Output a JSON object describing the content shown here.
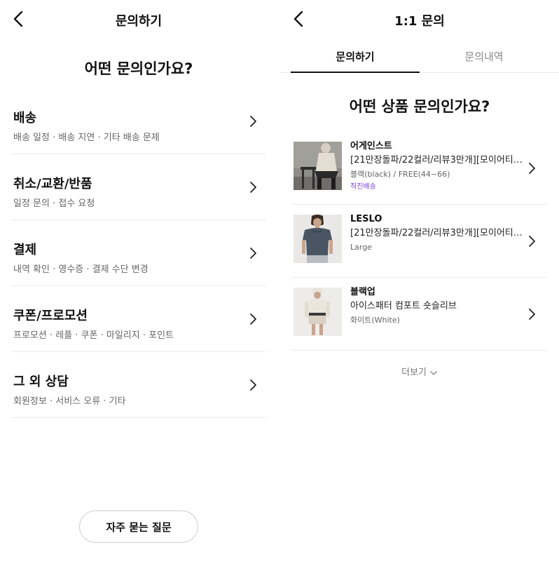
{
  "left": {
    "title": "문의하기",
    "question": "어떤 문의인가요?",
    "categories": [
      {
        "title": "배송",
        "sub": "배송 일정 · 배송 지연 · 기타 배송 문제"
      },
      {
        "title": "취소/교환/반품",
        "sub": "일정 문의 · 접수 요청"
      },
      {
        "title": "결제",
        "sub": "내역 확인 · 영수증 · 결제 수단 변경"
      },
      {
        "title": "쿠폰/프로모션",
        "sub": "프로모션 · 레플 · 쿠폰 · 마일리지 · 포인트"
      },
      {
        "title": "그 외 상담",
        "sub": "회원정보 · 서비스 오류 · 기타"
      }
    ],
    "faq_button": "자주 묻는 질문"
  },
  "right": {
    "title": "1:1 문의",
    "tabs": [
      "문의하기",
      "문의내역"
    ],
    "question": "어떤 상품 문의인가요?",
    "products": [
      {
        "brand": "어게인스트",
        "name": "[21만장돌파/22컬러/리뷰3만개][모이어티]...",
        "option": "블랙(black) / FREE(44~66)",
        "badge": "직진배송"
      },
      {
        "brand": "LESLO",
        "name": "[21만장돌파/22컬러/리뷰3만개][모이어티]...",
        "option": "Large"
      },
      {
        "brand": "블랙업",
        "name": "아이스패터 컴포트 숏슬리브",
        "option": "화이트(White)"
      }
    ],
    "more_label": "더보기"
  },
  "colors": {
    "accent_purple": "#7a44e0",
    "divider": "#ececec",
    "text": "#111111",
    "muted": "#666666"
  },
  "icons": {
    "back": "chevron-left-icon",
    "row": "chevron-right-icon",
    "more": "chevron-down-icon"
  }
}
